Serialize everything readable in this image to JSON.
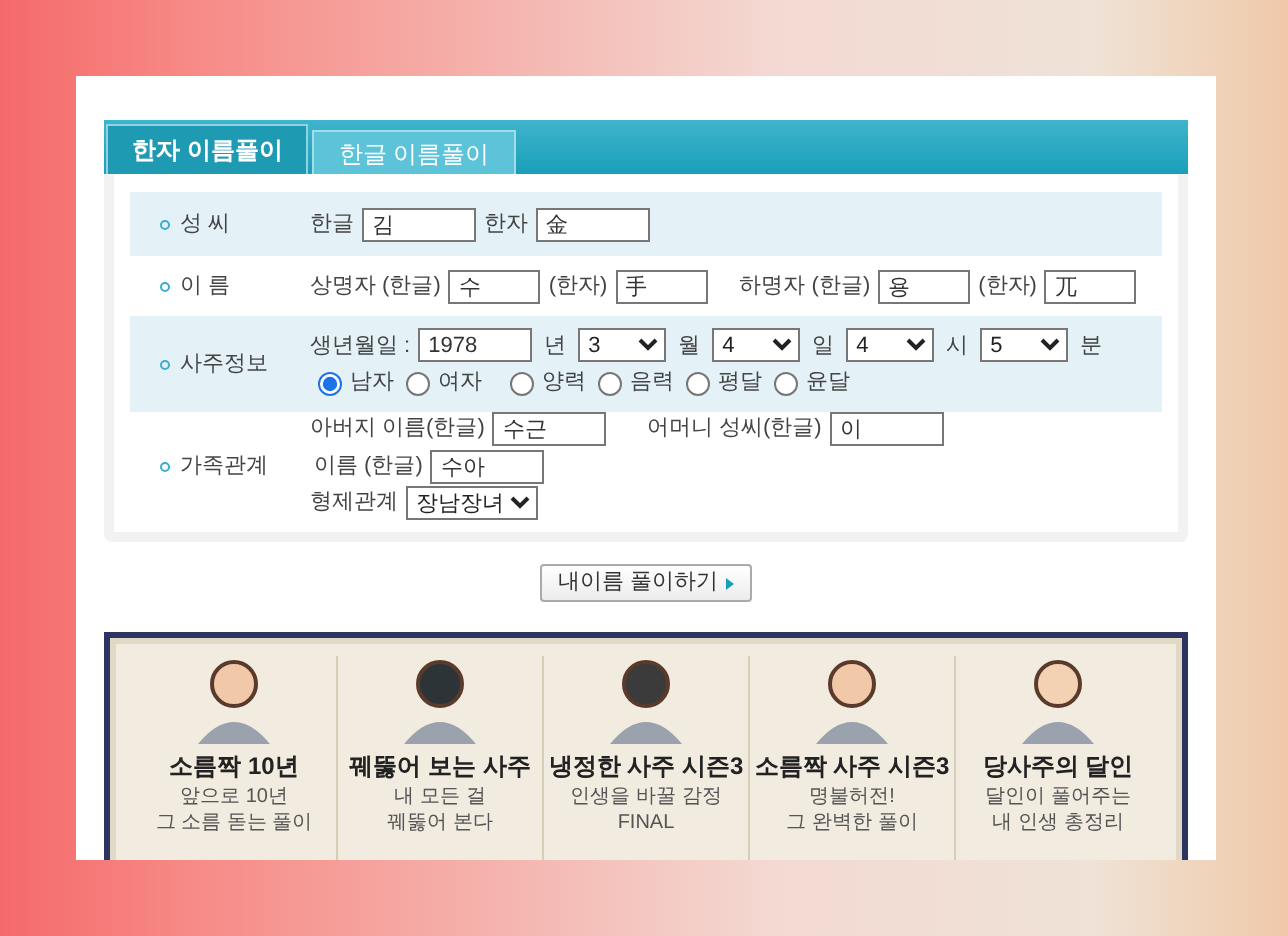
{
  "tabs": [
    {
      "label": "한자 이름풀이",
      "selected": true
    },
    {
      "label": "한글 이름풀이",
      "selected": false
    }
  ],
  "surname": {
    "label": "성 씨",
    "parts": [
      {
        "label": "한글",
        "value": "김"
      },
      {
        "label": "한자",
        "value": "金"
      }
    ]
  },
  "given_name": {
    "label": "이 름",
    "parts": [
      {
        "label": "상명자 (한글)",
        "value": "수"
      },
      {
        "label": "(한자)",
        "value": "手"
      },
      {
        "label": "하명자 (한글)",
        "value": "용"
      },
      {
        "label": "(한자)",
        "value": "兀"
      }
    ]
  },
  "saju": {
    "label": "사주정보",
    "birth_label": "생년월일 :",
    "year": "1978",
    "year_unit": "년",
    "selects": [
      {
        "value": "3",
        "unit": "월"
      },
      {
        "value": "4",
        "unit": "일"
      },
      {
        "value": "4",
        "unit": "시"
      },
      {
        "value": "5",
        "unit": "분"
      }
    ],
    "radio_groups": [
      {
        "options": [
          {
            "label": "남자",
            "selected": true
          },
          {
            "label": "여자",
            "selected": false
          }
        ]
      },
      {
        "options": [
          {
            "label": "양력",
            "selected": false
          },
          {
            "label": "음력",
            "selected": false
          },
          {
            "label": "평달",
            "selected": false
          },
          {
            "label": "윤달",
            "selected": false
          }
        ]
      }
    ]
  },
  "family": {
    "label": "가족관계",
    "father_label": "아버지 이름(한글)",
    "father_value": "수근",
    "mother_surname_label": "어머니 성씨(한글)",
    "mother_surname_value": "이",
    "mother_name_label": "이름 (한글)",
    "mother_name_value": "수아",
    "sibling_label": "형제관계",
    "sibling_value": "장남장녀"
  },
  "submit_button": "내이름 풀이하기",
  "banner_cards": [
    {
      "title": "소름짝 10년",
      "subtitle_lines": [
        "앞으로 10년",
        "그 소름 돋는 풀이"
      ]
    },
    {
      "title": "꿰뚫어 보는 사주",
      "subtitle_lines": [
        "내 모든 걸",
        "꿰뚫어 본다"
      ]
    },
    {
      "title": "냉정한 사주 시즌3",
      "subtitle_lines": [
        "인생을 바꿀 감정",
        "FINAL"
      ]
    },
    {
      "title": "소름짝 사주 시즌3",
      "subtitle_lines": [
        "명불허전!",
        "그 완벽한 풀이"
      ]
    },
    {
      "title": "당사주의 달인",
      "subtitle_lines": [
        "달인이 풀어주는",
        "내 인생 총정리"
      ]
    }
  ]
}
